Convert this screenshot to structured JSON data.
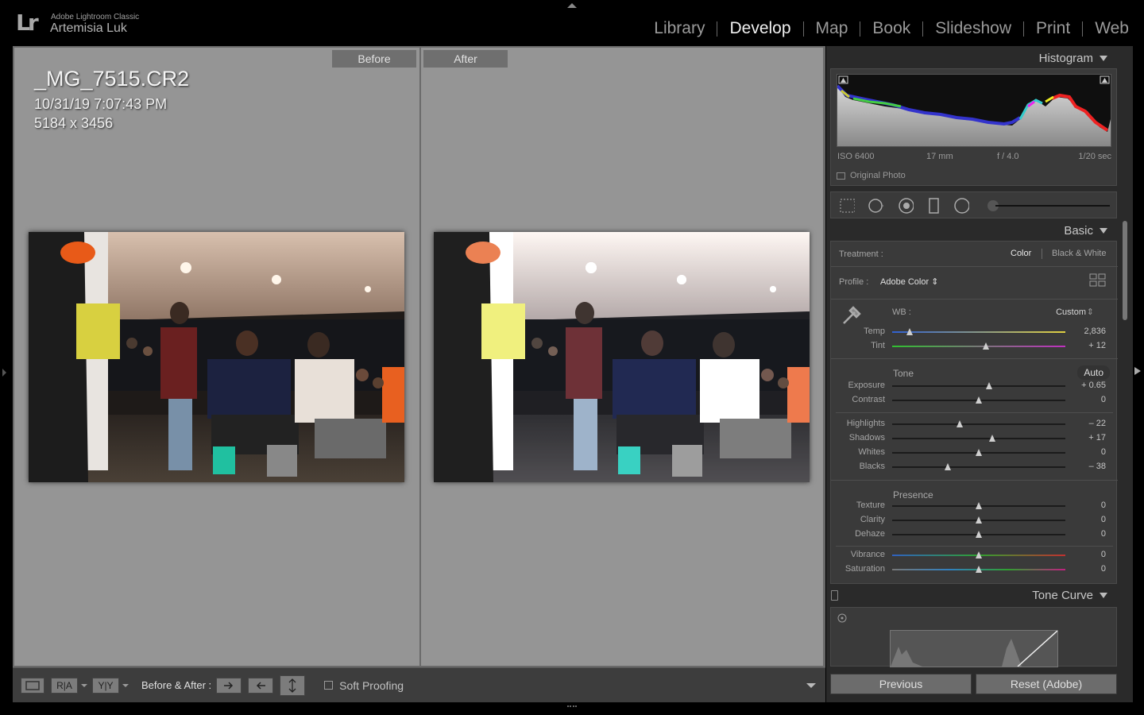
{
  "topbar": {
    "logo": "Lr",
    "app_name": "Adobe Lightroom Classic",
    "user_name": "Artemisia Luk",
    "modules": [
      "Library",
      "Develop",
      "Map",
      "Book",
      "Slideshow",
      "Print",
      "Web"
    ],
    "active_module": "Develop"
  },
  "view": {
    "before_label": "Before",
    "after_label": "After",
    "file_name": "_MG_7515.CR2",
    "date": "10/31/19 7:07:43 PM",
    "dimensions": "5184 x 3456"
  },
  "toolbar": {
    "view_a_label": "R|A",
    "view_b_label": "Y|Y",
    "before_after_label": "Before & After :",
    "soft_proofing_label": "Soft Proofing",
    "soft_proofing_checked": false
  },
  "histogram": {
    "title": "Histogram",
    "iso": "ISO 6400",
    "focal": "17 mm",
    "aperture": "f / 4.0",
    "shutter": "1/20 sec",
    "original_photo_label": "Original Photo"
  },
  "basic": {
    "title": "Basic",
    "treatment_label": "Treatment :",
    "treatment_color": "Color",
    "treatment_bw": "Black & White",
    "profile_label": "Profile :",
    "profile_value": "Adobe Color",
    "wb_label": "WB :",
    "wb_value": "Custom",
    "tone_label": "Tone",
    "auto_label": "Auto",
    "presence_label": "Presence",
    "sliders": [
      {
        "name": "Temp",
        "value": "2,836",
        "pos": 0.1
      },
      {
        "name": "Tint",
        "value": "+ 12",
        "pos": 0.54
      },
      {
        "name": "Exposure",
        "value": "+ 0.65",
        "pos": 0.56
      },
      {
        "name": "Contrast",
        "value": "0",
        "pos": 0.5
      },
      {
        "name": "Highlights",
        "value": "– 22",
        "pos": 0.39
      },
      {
        "name": "Shadows",
        "value": "+ 17",
        "pos": 0.58
      },
      {
        "name": "Whites",
        "value": "0",
        "pos": 0.5
      },
      {
        "name": "Blacks",
        "value": "– 38",
        "pos": 0.32
      },
      {
        "name": "Texture",
        "value": "0",
        "pos": 0.5
      },
      {
        "name": "Clarity",
        "value": "0",
        "pos": 0.5
      },
      {
        "name": "Dehaze",
        "value": "0",
        "pos": 0.5
      },
      {
        "name": "Vibrance",
        "value": "0",
        "pos": 0.5
      },
      {
        "name": "Saturation",
        "value": "0",
        "pos": 0.5
      }
    ]
  },
  "tone_curve": {
    "title": "Tone Curve"
  },
  "buttons": {
    "previous": "Previous",
    "reset": "Reset (Adobe)"
  },
  "colors": {
    "panel": "#2a2a2a",
    "view_bg": "#959595",
    "accent": "#f0f0f0"
  }
}
